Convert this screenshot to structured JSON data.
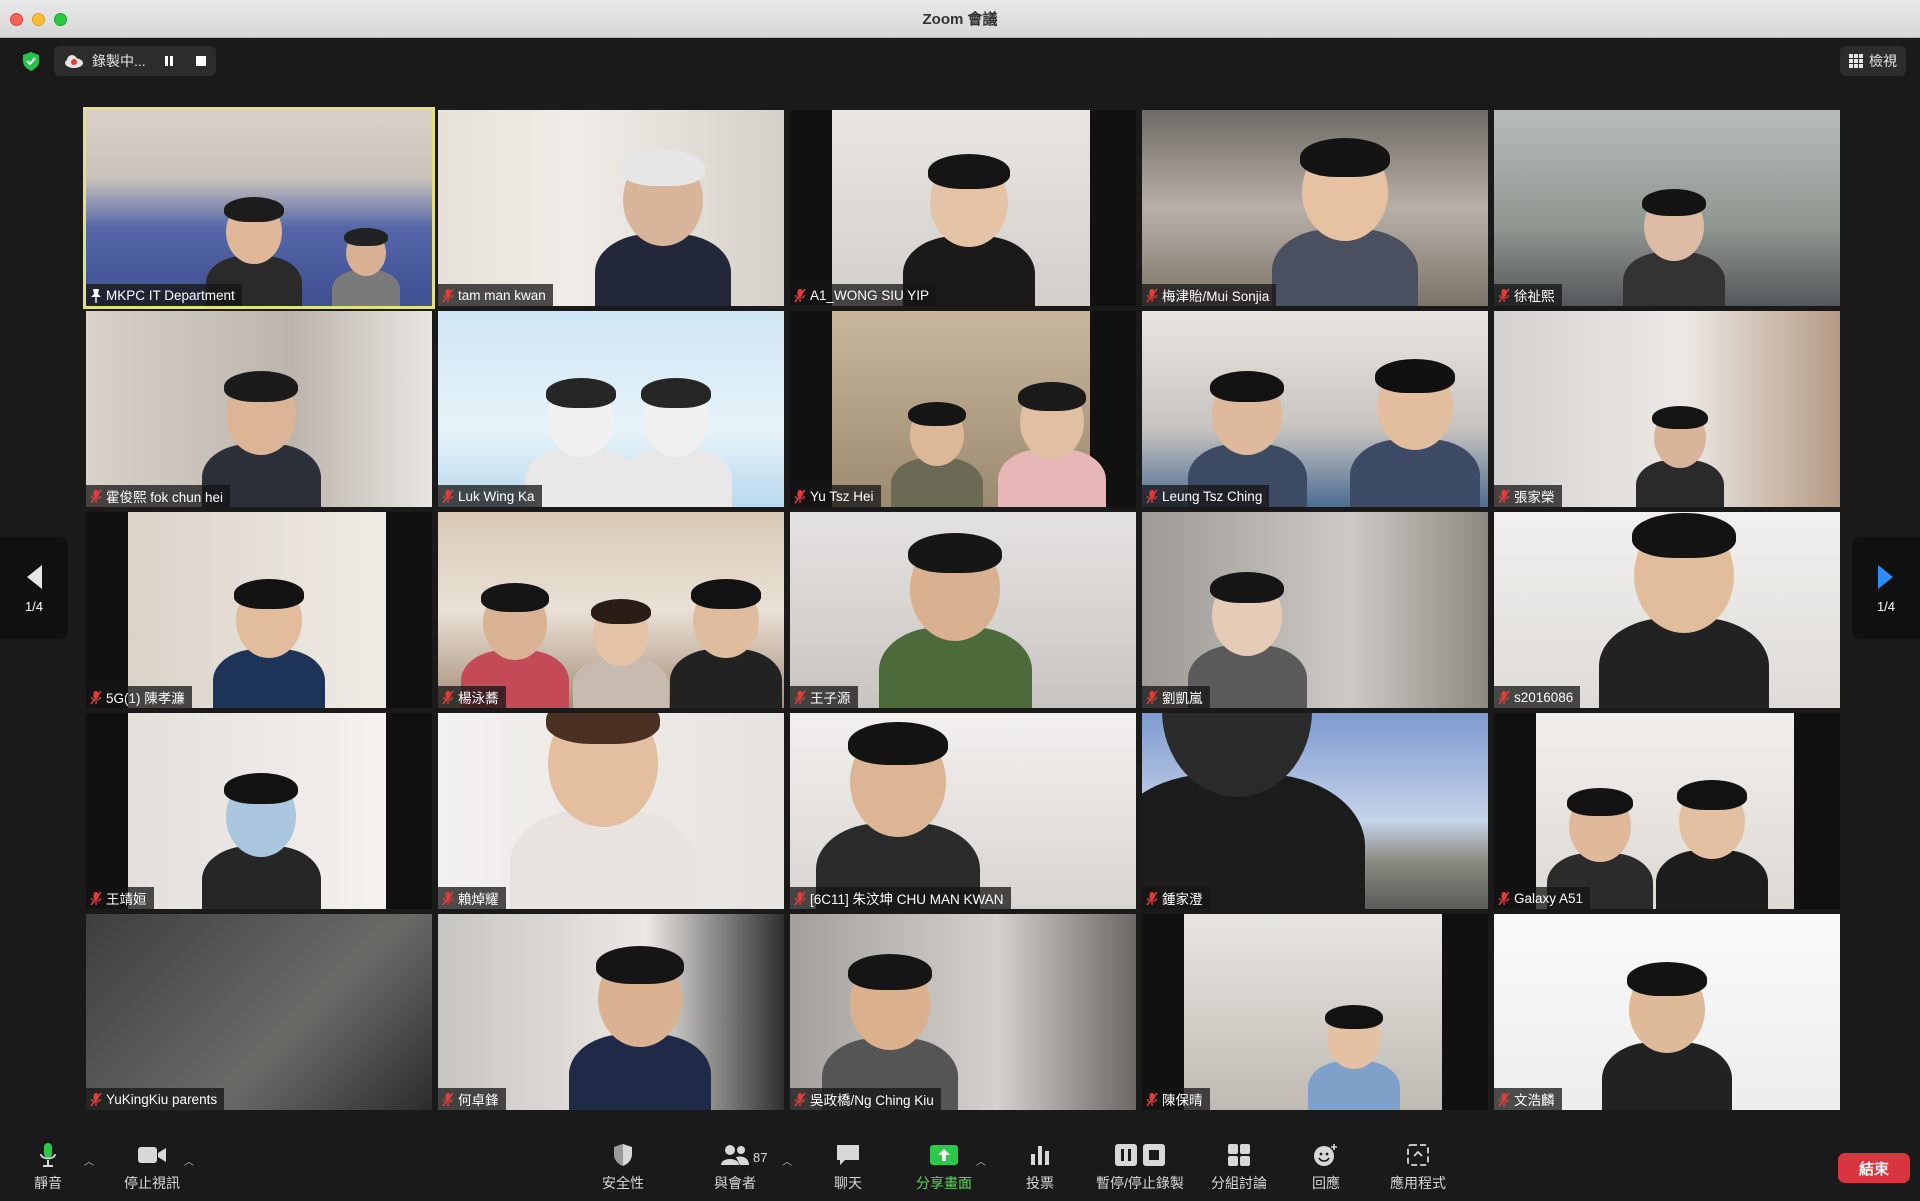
{
  "window": {
    "title": "Zoom 會議"
  },
  "topbar": {
    "recording_label": "錄製中...",
    "view_label": "檢視"
  },
  "pagination": {
    "left": "1/4",
    "right": "1/4"
  },
  "participants": [
    {
      "name": "MKPC IT Department",
      "active": true,
      "pinned": true,
      "scene": "hall"
    },
    {
      "name": "tam man kwan",
      "scene": "elder"
    },
    {
      "name": "A1_WONG SIU YIP",
      "scene": "teen"
    },
    {
      "name": "梅津貽/Mui Sonjia",
      "scene": "girl"
    },
    {
      "name": "徐祉熙",
      "scene": "room"
    },
    {
      "name": "霍俊熙 fok chun hei",
      "scene": "boy"
    },
    {
      "name": "Luk Wing Ka",
      "scene": "penguins"
    },
    {
      "name": "Yu Tsz Hei",
      "scene": "family"
    },
    {
      "name": "Leung  Tsz  Ching",
      "scene": "pair"
    },
    {
      "name": "張家榮",
      "scene": "room2"
    },
    {
      "name": "5G(1) 陳孝濂",
      "scene": "boy2"
    },
    {
      "name": "楊泳蕎",
      "scene": "group"
    },
    {
      "name": "王子源",
      "scene": "kid"
    },
    {
      "name": "劉凱嵐",
      "scene": "dim"
    },
    {
      "name": "s2016086",
      "scene": "smile"
    },
    {
      "name": "王靖姮",
      "scene": "mask"
    },
    {
      "name": "賴焯耀",
      "scene": "woman"
    },
    {
      "name": "[6C11] 朱汶坤 CHU MAN KWAN",
      "scene": "kid2"
    },
    {
      "name": "鍾家澄",
      "scene": "sky"
    },
    {
      "name": "Galaxy A51",
      "scene": "pair2"
    },
    {
      "name": "YuKingKiu parents",
      "scene": "dark"
    },
    {
      "name": "何卓鋒",
      "scene": "boy3"
    },
    {
      "name": "吳政橋/Ng Ching Kiu",
      "scene": "blur"
    },
    {
      "name": "陳保晴",
      "scene": "girl2"
    },
    {
      "name": "文浩麟",
      "scene": "glasses"
    }
  ],
  "toolbar": {
    "mute": "靜音",
    "stop_video": "停止視訊",
    "security": "安全性",
    "participants": "與會者",
    "participants_count": "87",
    "chat": "聊天",
    "share_screen": "分享畫面",
    "polls": "投票",
    "pause_stop_recording": "暫停/停止錄製",
    "breakout_rooms": "分組討論",
    "reactions": "回應",
    "apps": "應用程式",
    "end": "結束"
  }
}
